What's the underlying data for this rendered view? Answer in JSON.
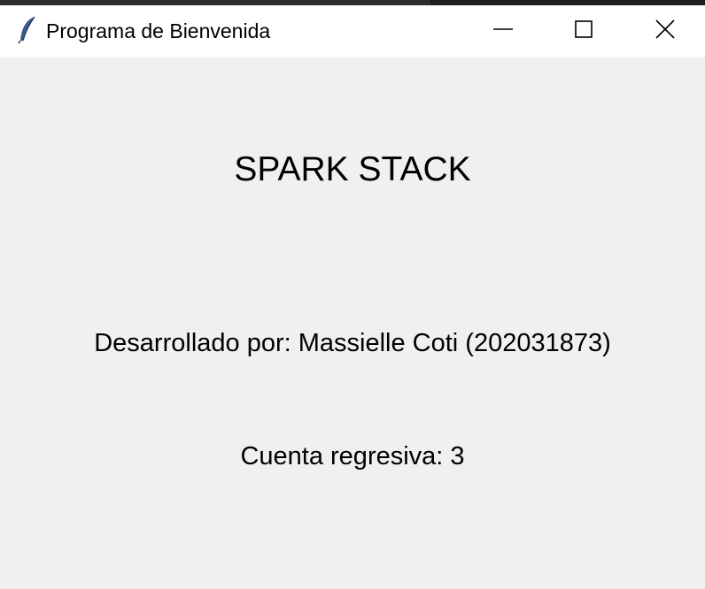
{
  "window": {
    "title": "Programa de Bienvenida",
    "controls": {
      "minimize": "minimize-icon",
      "maximize": "maximize-icon",
      "close": "close-icon"
    },
    "icon": "feather-icon"
  },
  "main": {
    "heading": "SPARK STACK",
    "developer_text": "Desarrollado por: Massielle Coti (202031873)",
    "countdown_text": "Cuenta regresiva: 3"
  },
  "colors": {
    "window_background": "#f0f0f0",
    "titlebar_background": "#ffffff",
    "text": "#000000"
  }
}
